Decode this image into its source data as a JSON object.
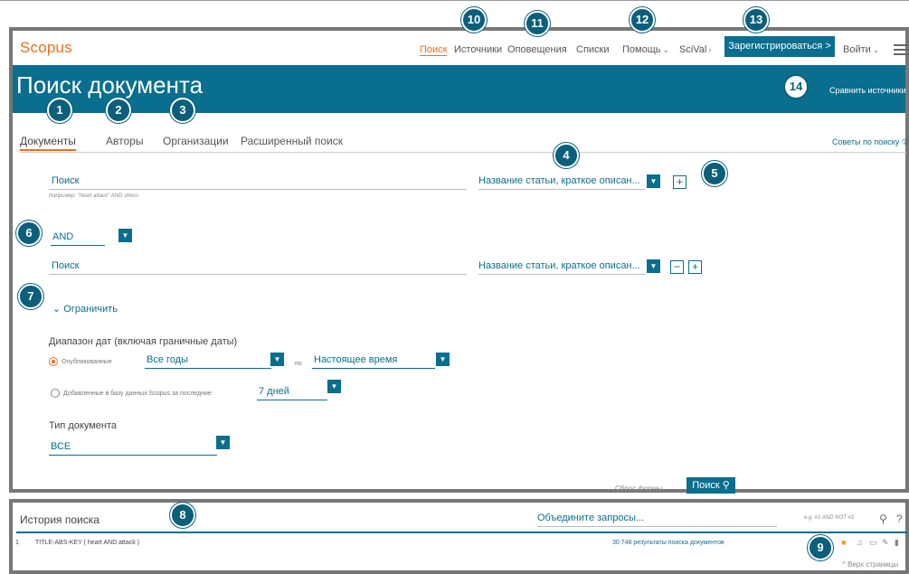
{
  "app": {
    "logo": "Scopus"
  },
  "nav": {
    "items": [
      {
        "label": "Поиск"
      },
      {
        "label": "Источники"
      },
      {
        "label": "Оповещения"
      },
      {
        "label": "Списки"
      },
      {
        "label": "Помощь"
      },
      {
        "label": "SciVal"
      }
    ],
    "register": "Зарегистрироваться >",
    "login": "Войти"
  },
  "banner": {
    "title": "Поиск документа",
    "compare": "Сравнить источники"
  },
  "tabs": [
    "Документы",
    "Авторы",
    "Организации",
    "Расширенный поиск"
  ],
  "tips": "Советы по поиску ⑦",
  "search": {
    "row1": {
      "placeholder": "Поиск",
      "field": "Название статьи, краткое описан..."
    },
    "example": "Например: \"heart attack\" AND stress",
    "operator": "AND",
    "row2": {
      "placeholder": "Поиск",
      "field": "Название статьи, краткое описан..."
    }
  },
  "limit": {
    "toggle": "Ограничить",
    "date_range_label": "Диапазон дат (включая граничные даты)",
    "published_label": "Опубликованные",
    "from": "Все годы",
    "to_label": "по",
    "to": "Настоящее время",
    "added_label": "Добавленные в базу данных Scopus за последние",
    "added_value": "7 дней",
    "doctype_label": "Тип документа",
    "doctype_value": "ВСЕ"
  },
  "actions": {
    "reset": "Сброс формы",
    "search": "Поиск"
  },
  "history": {
    "title": "История поиска",
    "combine_placeholder": "Объедините запросы...",
    "combine_example": "e.g. #1 AND NOT #3",
    "rows": [
      {
        "num": "1",
        "query": "TITLE-ABS-KEY ( heart AND attack )",
        "results": "30 748 результаты поиска документов"
      }
    ],
    "top_link": "^ Верх страницы"
  },
  "callouts": [
    "1",
    "2",
    "3",
    "4",
    "5",
    "6",
    "7",
    "8",
    "9",
    "10",
    "11",
    "12",
    "13",
    "14"
  ],
  "colors": {
    "accent": "#e9711c",
    "brand": "#0a6e8f",
    "callout": "#0b5f7c"
  }
}
